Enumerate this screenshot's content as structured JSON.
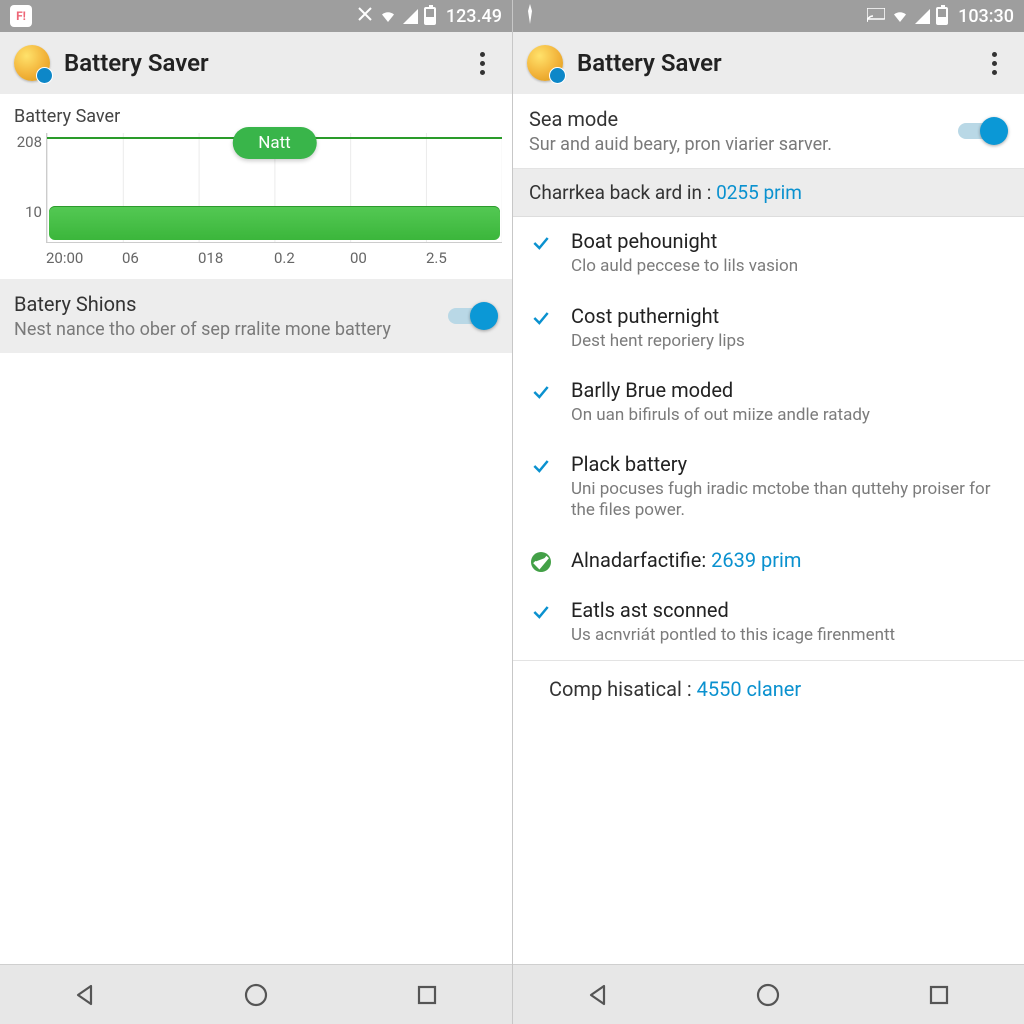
{
  "left": {
    "status": {
      "time": "123.49"
    },
    "appbar": {
      "title": "Battery Saver"
    },
    "chart_section_label": "Battery Saver",
    "chart_chip": "Natt",
    "switch_row": {
      "title": "Batery Shions",
      "sub": "Nest nance tho ober of sep rralite mone battery"
    }
  },
  "right": {
    "status": {
      "time": "103:30"
    },
    "appbar": {
      "title": "Battery Saver"
    },
    "sea": {
      "title": "Sea mode",
      "sub": "Sur and auid beary, pron viarier sarver."
    },
    "section_strip": {
      "prefix": "Charrkea back ard in : ",
      "accent": "0255 prim"
    },
    "items": [
      {
        "title": "Boat pehounight",
        "sub": "Clo auld peccese to lils vasion"
      },
      {
        "title": "Cost puthernight",
        "sub": "Dest hent reporiery lips"
      },
      {
        "title": "Barlly Brue moded",
        "sub": "On uan bifiruls of out miize andle ratady"
      },
      {
        "title": "Plack battery",
        "sub": "Uni pocuses fugh iradic mctobe than quttehy proiser for the files power."
      }
    ],
    "alna": {
      "prefix": "Alnadarfactifie: ",
      "accent": "2639 prim"
    },
    "eatls": {
      "title": "Eatls ast sconned",
      "sub": "Us acnvriát pontled to this icage firenmentt"
    },
    "comp": {
      "prefix": "Comp hisatical : ",
      "accent": "4550 claner"
    }
  },
  "chart_data": {
    "type": "area",
    "title": "Battery Saver",
    "xlabel": "",
    "ylabel": "",
    "y_ticks": [
      "208",
      "10"
    ],
    "x_ticks": [
      "20:00",
      "06",
      "018",
      "0.2",
      "00",
      "2.5"
    ],
    "ylim": [
      0,
      208
    ],
    "annotation": "Natt",
    "series": [
      {
        "name": "battery-level",
        "x": [
          "20:00",
          "06",
          "018",
          "0.2",
          "00",
          "2.5"
        ],
        "values": [
          35,
          36,
          34,
          36,
          35,
          35
        ]
      },
      {
        "name": "upper-line",
        "x": [
          "20:00",
          "06",
          "018",
          "0.2",
          "00",
          "2.5"
        ],
        "values": [
          200,
          200,
          200,
          200,
          200,
          200
        ]
      }
    ]
  }
}
